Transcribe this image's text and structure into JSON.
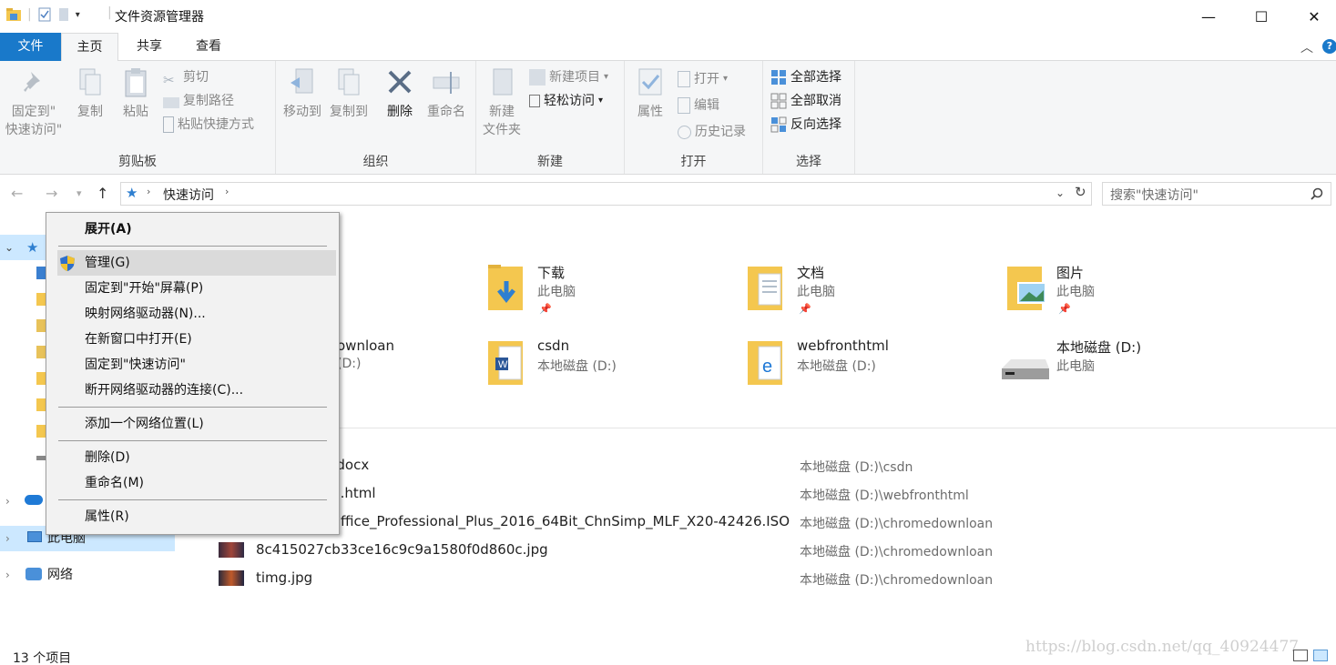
{
  "window": {
    "title": "文件资源管理器",
    "min_icon": "—",
    "max_icon": "☐",
    "close_icon": "✕"
  },
  "tabs": {
    "file": "文件",
    "home": "主页",
    "share": "共享",
    "view": "查看"
  },
  "ribbon": {
    "clipboard": {
      "label": "剪贴板",
      "pin_line1": "固定到\"",
      "pin_line2": "快速访问\"",
      "copy": "复制",
      "paste": "粘贴",
      "cut": "剪切",
      "copy_path": "复制路径",
      "paste_shortcut": "粘贴快捷方式"
    },
    "organize": {
      "label": "组织",
      "move_to": "移动到",
      "copy_to": "复制到",
      "delete": "删除",
      "rename": "重命名"
    },
    "new": {
      "label": "新建",
      "new_folder_line1": "新建",
      "new_folder_line2": "文件夹",
      "new_item": "新建项目",
      "easy_access": "轻松访问"
    },
    "open": {
      "label": "打开",
      "properties": "属性",
      "open": "打开",
      "edit": "编辑",
      "history": "历史记录"
    },
    "select": {
      "label": "选择",
      "select_all": "全部选择",
      "select_none": "全部取消",
      "invert": "反向选择"
    }
  },
  "address": {
    "crumb": "快速访问",
    "search_placeholder": "搜索\"快速访问\""
  },
  "navpane": {
    "this_pc": "此电脑",
    "network": "网络"
  },
  "frequent": [
    {
      "name": "下载",
      "sub": "此电脑"
    },
    {
      "name": "文档",
      "sub": "此电脑"
    },
    {
      "name": "图片",
      "sub": "此电脑"
    },
    {
      "name": "ownloan",
      "sub": "(D:)"
    },
    {
      "name": "csdn",
      "sub": "本地磁盘 (D:)"
    },
    {
      "name": "webfronthtml",
      "sub": "本地磁盘 (D:)"
    },
    {
      "name": "本地磁盘 (D:)",
      "sub": "此电脑"
    }
  ],
  "recent": [
    {
      "name": ")  .docx",
      "path": "本地磁盘 (D:)\\csdn"
    },
    {
      "name": "ss.html",
      "path": "本地磁盘 (D:)\\webfronthtml"
    },
    {
      "name": "ffice_Professional_Plus_2016_64Bit_ChnSimp_MLF_X20-42426.ISO",
      "path": "本地磁盘 (D:)\\chromedownloan"
    },
    {
      "name": "8c415027cb33ce16c9c9a1580f0d860c.jpg",
      "path": "本地磁盘 (D:)\\chromedownloan"
    },
    {
      "name": "timg.jpg",
      "path": "本地磁盘 (D:)\\chromedownloan"
    }
  ],
  "context_menu": {
    "expand": "展开(A)",
    "manage": "管理(G)",
    "pin_start": "固定到\"开始\"屏幕(P)",
    "map_drive": "映射网络驱动器(N)...",
    "open_new_window": "在新窗口中打开(E)",
    "pin_quick": "固定到\"快速访问\"",
    "disconnect": "断开网络驱动器的连接(C)...",
    "add_location": "添加一个网络位置(L)",
    "delete": "删除(D)",
    "rename": "重命名(M)",
    "properties": "属性(R)"
  },
  "status": {
    "count": "13 个项目",
    "watermark": "https://blog.csdn.net/qq_40924477"
  },
  "colors": {
    "accent": "#1979ca",
    "selection": "#cce8ff",
    "folder": "#f4c74f"
  }
}
